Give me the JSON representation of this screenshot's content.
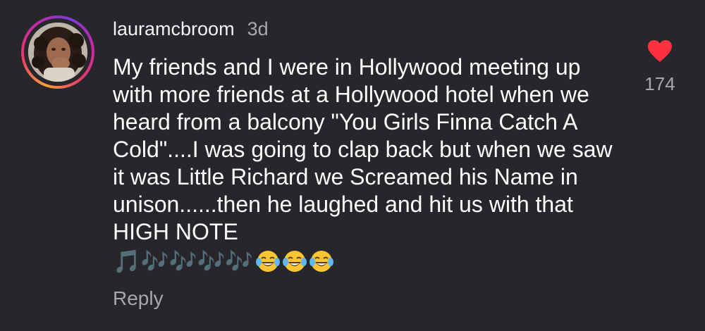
{
  "comment": {
    "username": "lauramcbroom",
    "timestamp": "3d",
    "text": "My friends and I were in Hollywood meeting up with more friends at a Hollywood hotel when we heard from a balcony \"You Girls Finna Catch A Cold\"....I was going to clap back but when we saw it was Little Richard we Screamed his Name in unison......then he laughed and hit us with that HIGH NOTE",
    "emoji_notes": "🎵🎶🎶🎶🎶",
    "reply_label": "Reply",
    "like_count": "174",
    "like_icon": "heart-icon",
    "accent_colors": {
      "heart": "#ff3040",
      "notes": "#b07cff",
      "ring_start": "#f9a13a",
      "ring_end": "#c32aa3"
    }
  }
}
